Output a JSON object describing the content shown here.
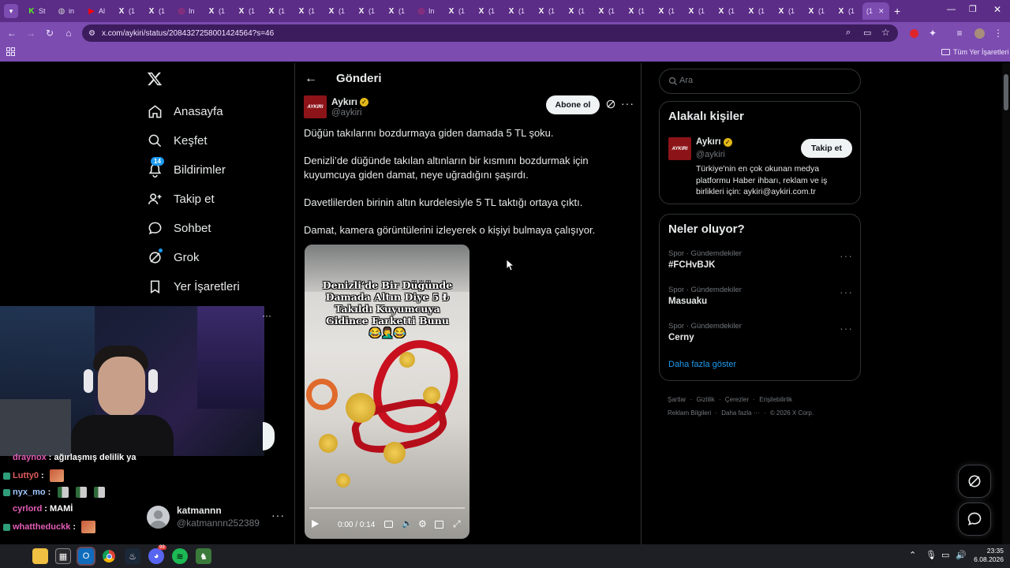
{
  "browser": {
    "tabs": [
      {
        "label": "St",
        "icon": "K",
        "color": "#53fc18"
      },
      {
        "label": "in",
        "icon": "globe",
        "color": "#ccc"
      },
      {
        "label": "Al",
        "icon": "youtube",
        "color": "#ff0000"
      },
      {
        "label": "(1",
        "icon": "X",
        "color": "#fff"
      },
      {
        "label": "(1",
        "icon": "X",
        "color": "#fff"
      },
      {
        "label": "In",
        "icon": "instagram",
        "color": "#e1306c"
      },
      {
        "label": "(1",
        "icon": "X",
        "color": "#fff"
      },
      {
        "label": "(1",
        "icon": "X",
        "color": "#fff"
      },
      {
        "label": "(1",
        "icon": "X",
        "color": "#fff"
      },
      {
        "label": "(1",
        "icon": "X",
        "color": "#fff"
      },
      {
        "label": "(1",
        "icon": "X",
        "color": "#fff"
      },
      {
        "label": "(1",
        "icon": "X",
        "color": "#fff"
      },
      {
        "label": "(1",
        "icon": "X",
        "color": "#fff"
      },
      {
        "label": "In",
        "icon": "instagram",
        "color": "#e1306c"
      },
      {
        "label": "(1",
        "icon": "X",
        "color": "#fff"
      },
      {
        "label": "(1",
        "icon": "X",
        "color": "#fff"
      },
      {
        "label": "(1",
        "icon": "X",
        "color": "#fff"
      },
      {
        "label": "(1",
        "icon": "X",
        "color": "#fff"
      },
      {
        "label": "(1",
        "icon": "X",
        "color": "#fff"
      },
      {
        "label": "(1",
        "icon": "X",
        "color": "#fff"
      },
      {
        "label": "(1",
        "icon": "X",
        "color": "#fff"
      },
      {
        "label": "(1",
        "icon": "X",
        "color": "#fff"
      },
      {
        "label": "(1",
        "icon": "X",
        "color": "#fff"
      },
      {
        "label": "(1",
        "icon": "X",
        "color": "#fff"
      },
      {
        "label": "(1",
        "icon": "X",
        "color": "#fff"
      },
      {
        "label": "(1",
        "icon": "X",
        "color": "#fff"
      },
      {
        "label": "(1",
        "icon": "X",
        "color": "#fff"
      },
      {
        "label": "(1",
        "icon": "X",
        "color": "#fff"
      }
    ],
    "active_tab_label": "(1",
    "url": "x.com/aykiri/status/2084327258001424564?s=46",
    "bookmarks_label": "Tüm Yer İşaretleri"
  },
  "nav": {
    "home": "Anasayfa",
    "explore": "Keşfet",
    "notifications": "Bildirimler",
    "notifications_badge": "14",
    "follow": "Takip et",
    "chat": "Sohbet",
    "grok": "Grok",
    "bookmarks": "Yer İşaretleri",
    "account_name": "katmannn",
    "account_handle": "@katmannn252389"
  },
  "post": {
    "header": "Gönderi",
    "author_name": "Aykırı",
    "author_handle": "@aykiri",
    "avatar_text": "AYKIRI",
    "subscribe": "Abone ol",
    "paragraphs": [
      "Düğün takılarını bozdurmaya giden damada 5 TL şoku.",
      "Denizli’de düğünde takılan altınların bir kısmını bozdurmak için kuyumcuya giden damat, neye uğradığını şaşırdı.",
      "Davetlilerden birinin altın kurdelesiyle 5 TL taktığı ortaya çıktı.",
      "Damat, kamera görüntülerini izleyerek o kişiyi bulmaya çalışıyor."
    ],
    "video_caption": "Denizli’de Bir Düğünde Damada Altın Diye 5 ₺ Takıldı Kuyumcuya Gidince Farketti Bunu😂🤦‍♂️😂",
    "video_time": "0:00 / 0:14"
  },
  "sidebar": {
    "search_placeholder": "Ara",
    "relevant_title": "Alakalı kişiler",
    "person_name": "Aykırı",
    "person_handle": "@aykiri",
    "follow_button": "Takip et",
    "person_bio": "Türkiye'nin en çok okunan medya platformu Haber ihbarı, reklam ve iş birlikleri için: aykiri@aykiri.com.tr",
    "trends_title": "Neler oluyor?",
    "trends": [
      {
        "category": "Spor · Gündemdekiler",
        "name": "#FCHvBJK"
      },
      {
        "category": "Spor · Gündemdekiler",
        "name": "Masuaku"
      },
      {
        "category": "Spor · Gündemdekiler",
        "name": "Cerny"
      }
    ],
    "show_more": "Daha fazla göster",
    "footer_line1": [
      "Şartlar",
      "Gizlilik",
      "Çerezler",
      "Erişilebilirlik"
    ],
    "footer_line2": [
      "Reklam Bilgileri",
      "Daha fazla ···",
      "© 2026 X Corp."
    ]
  },
  "stream_chat": [
    {
      "user": "draynox",
      "text": ": ağırlaşmış delilik ya",
      "color": "#e35db6"
    },
    {
      "user": "Lutty0",
      "text": ":",
      "color": "#e05b5b",
      "emote": true
    },
    {
      "user": "nyx_mo",
      "text": ":",
      "color": "#9ec7ff",
      "bottles": true
    },
    {
      "user": "cyrlord",
      "text": ": MAMİ",
      "color": "#e35db6"
    },
    {
      "user": "whattheduckk",
      "text": ":",
      "color": "#e35db6",
      "emote": true
    }
  ],
  "taskbar": {
    "time": "23:35",
    "date": "6.08.2026",
    "discord_badge": "99"
  },
  "colors": {
    "tab_bar": "#5b2d86",
    "toolbar": "#7c4cb0",
    "x_blue": "#1d9bf0",
    "verified_gold": "#e2b719"
  }
}
